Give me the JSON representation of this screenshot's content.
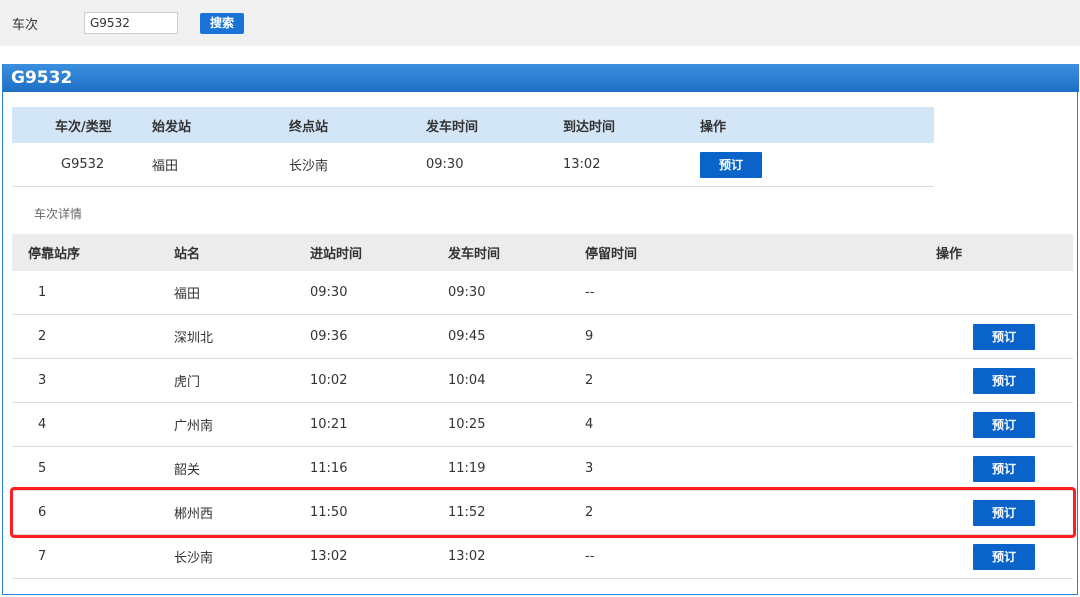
{
  "search": {
    "label": "车次",
    "value": "G9532",
    "button": "搜索"
  },
  "panel": {
    "title": "G9532"
  },
  "summary": {
    "headers": [
      "车次/类型",
      "始发站",
      "终点站",
      "发车时间",
      "到达时间",
      "操作"
    ],
    "row": {
      "train": "G9532",
      "from": "福田",
      "to": "长沙南",
      "depart": "09:30",
      "arrive": "13:02",
      "action": "预订"
    }
  },
  "detail": {
    "title": "车次详情",
    "headers": [
      "停靠站序",
      "站名",
      "进站时间",
      "发车时间",
      "停留时间",
      "操作"
    ],
    "rows": [
      {
        "seq": "1",
        "station": "福田",
        "arrive": "09:30",
        "depart": "09:30",
        "stay": "--",
        "action": ""
      },
      {
        "seq": "2",
        "station": "深圳北",
        "arrive": "09:36",
        "depart": "09:45",
        "stay": "9",
        "action": "预订"
      },
      {
        "seq": "3",
        "station": "虎门",
        "arrive": "10:02",
        "depart": "10:04",
        "stay": "2",
        "action": "预订"
      },
      {
        "seq": "4",
        "station": "广州南",
        "arrive": "10:21",
        "depart": "10:25",
        "stay": "4",
        "action": "预订"
      },
      {
        "seq": "5",
        "station": "韶关",
        "arrive": "11:16",
        "depart": "11:19",
        "stay": "3",
        "action": "预订"
      },
      {
        "seq": "6",
        "station": "郴州西",
        "arrive": "11:50",
        "depart": "11:52",
        "stay": "2",
        "action": "预订"
      },
      {
        "seq": "7",
        "station": "长沙南",
        "arrive": "13:02",
        "depart": "13:02",
        "stay": "--",
        "action": "预订"
      }
    ]
  },
  "colors": {
    "accent": "#0a63c9",
    "highlight": "#ff1f1f",
    "header_blue": "#d2e6f8"
  }
}
